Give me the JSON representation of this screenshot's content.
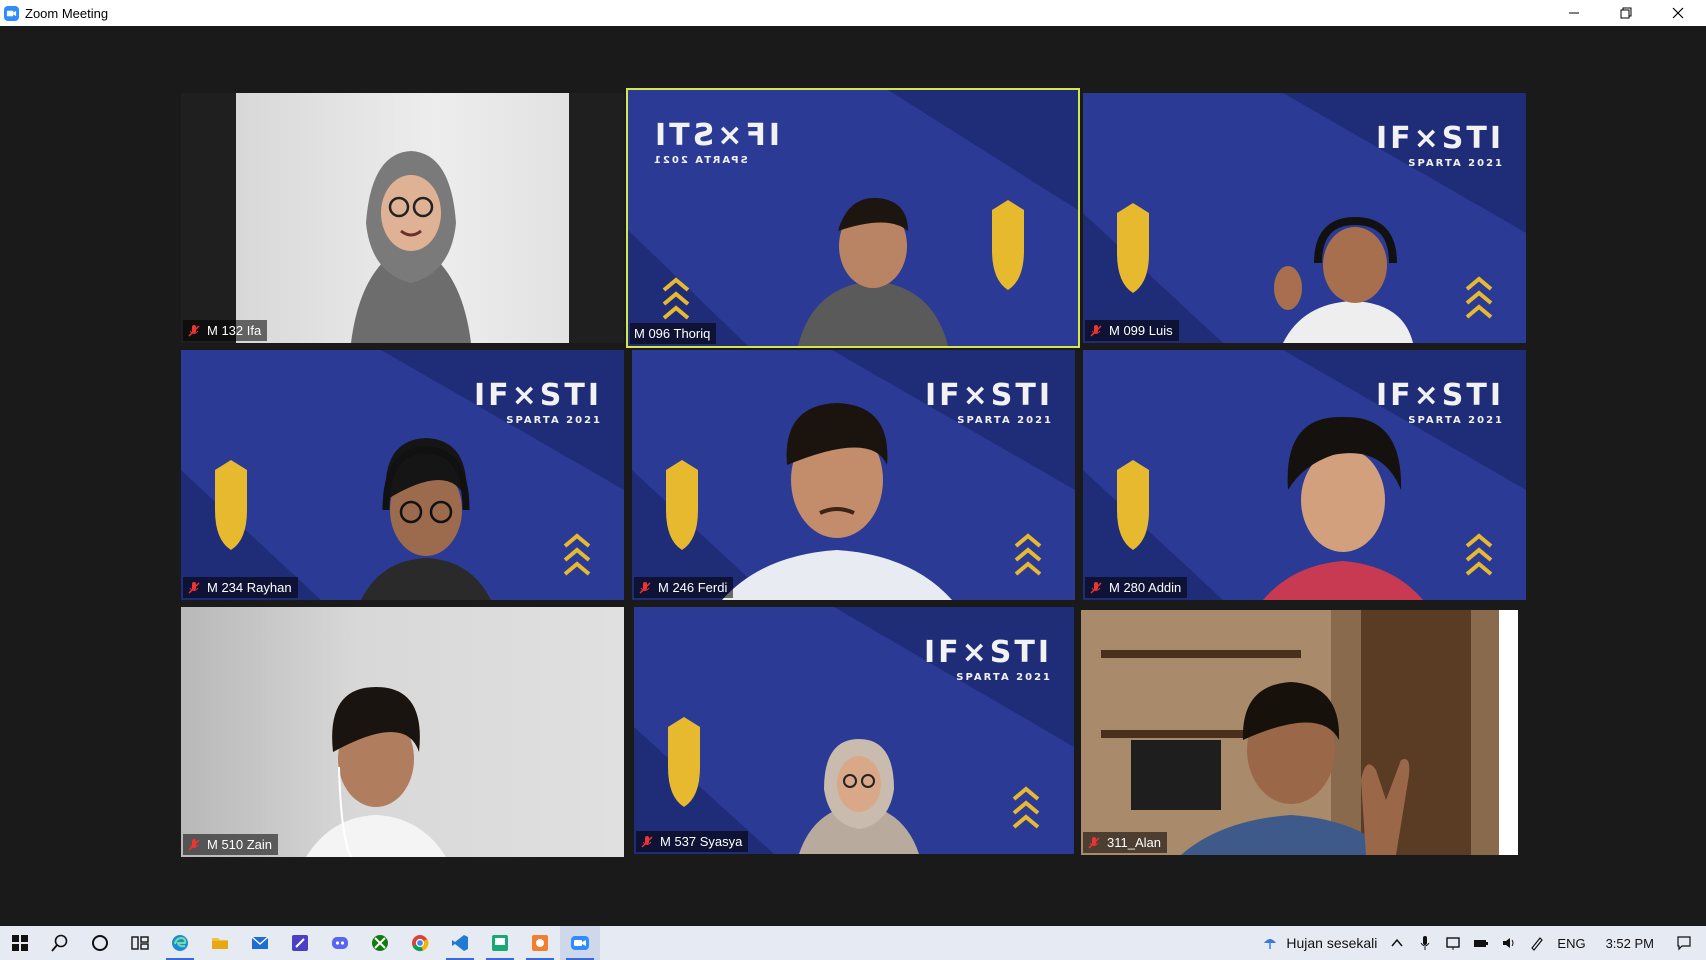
{
  "window": {
    "title": "Zoom Meeting"
  },
  "banner": {
    "brand": "IF×STI",
    "event": "SPARTA 2021"
  },
  "participants": [
    {
      "name": "M 132 Ifa"
    },
    {
      "name": "M 096 Thoriq"
    },
    {
      "name": "M 099 Luis"
    },
    {
      "name": "M 234 Rayhan"
    },
    {
      "name": "M 246 Ferdi"
    },
    {
      "name": "M 280 Addin"
    },
    {
      "name": "M 510 Zain"
    },
    {
      "name": "M 537 Syasya"
    },
    {
      "name": "311_Alan"
    }
  ],
  "taskbar": {
    "apps": [
      "windows-start",
      "search",
      "cortana",
      "task-view",
      "edge",
      "file-explorer",
      "mail",
      "notes",
      "discord",
      "xbox",
      "chrome",
      "vscode",
      "app-green",
      "app-orange",
      "zoom"
    ],
    "weather": "Hujan sesekali",
    "language": "ENG",
    "time": "3:52 PM"
  },
  "colors": {
    "active_speaker": "#d3e64a",
    "banner_bg": "#2a3a8c",
    "accent_gold": "#e7b92f"
  }
}
